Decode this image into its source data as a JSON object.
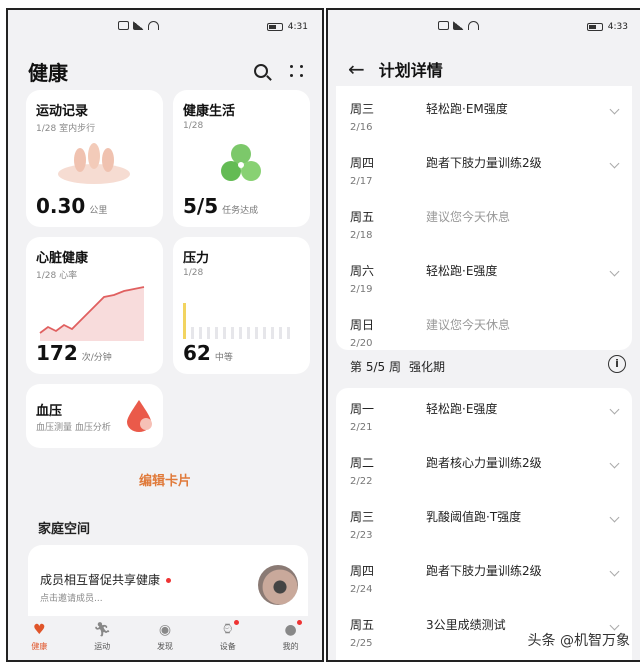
{
  "left_screen": {
    "status": {
      "time": "4:31"
    },
    "title": "健康",
    "cards": {
      "exercise": {
        "title": "运动记录",
        "sub": "1/28 室内步行",
        "value": "0.30",
        "unit": "公里"
      },
      "lifestyle": {
        "title": "健康生活",
        "sub": "1/28",
        "value": "5/5",
        "unit": "任务达成"
      },
      "heart": {
        "title": "心脏健康",
        "sub": "1/28 心率",
        "value": "172",
        "unit": "次/分钟"
      },
      "stress": {
        "title": "压力",
        "sub": "1/28",
        "value": "62",
        "unit": "中等"
      },
      "bp": {
        "title": "血压",
        "sub": "血压测量 血压分析"
      }
    },
    "edit_cards": "编辑卡片",
    "family_section": "家庭空间",
    "family_card": {
      "title": "成员相互督促共享健康",
      "sub": "点击邀请成员..."
    },
    "tabs": [
      {
        "label": "健康",
        "icon": "health-icon"
      },
      {
        "label": "运动",
        "icon": "run-icon"
      },
      {
        "label": "发现",
        "icon": "discover-icon"
      },
      {
        "label": "设备",
        "icon": "watch-icon"
      },
      {
        "label": "我的",
        "icon": "profile-icon"
      }
    ],
    "accent_color": "#e0552a"
  },
  "right_screen": {
    "status": {
      "time": "4:33"
    },
    "title": "计划详情",
    "week4_rows": [
      {
        "day": "周三",
        "date": "2/16",
        "desc": "轻松跑·EM强度",
        "rest": false
      },
      {
        "day": "周四",
        "date": "2/17",
        "desc": "跑者下肢力量训练2级",
        "rest": false
      },
      {
        "day": "周五",
        "date": "2/18",
        "desc": "建议您今天休息",
        "rest": true
      },
      {
        "day": "周六",
        "date": "2/19",
        "desc": "轻松跑·E强度",
        "rest": false
      },
      {
        "day": "周日",
        "date": "2/20",
        "desc": "建议您今天休息",
        "rest": true
      }
    ],
    "week_header": {
      "week": "第 5/5 周",
      "phase": "强化期"
    },
    "week5_rows": [
      {
        "day": "周一",
        "date": "2/21",
        "desc": "轻松跑·E强度",
        "rest": false
      },
      {
        "day": "周二",
        "date": "2/22",
        "desc": "跑者核心力量训练2级",
        "rest": false
      },
      {
        "day": "周三",
        "date": "2/23",
        "desc": "乳酸阈值跑·T强度",
        "rest": false
      },
      {
        "day": "周四",
        "date": "2/24",
        "desc": "跑者下肢力量训练2级",
        "rest": false
      },
      {
        "day": "周五",
        "date": "2/25",
        "desc": "3公里成绩测试",
        "rest": false
      }
    ]
  },
  "watermark": "头条 @机智万象"
}
